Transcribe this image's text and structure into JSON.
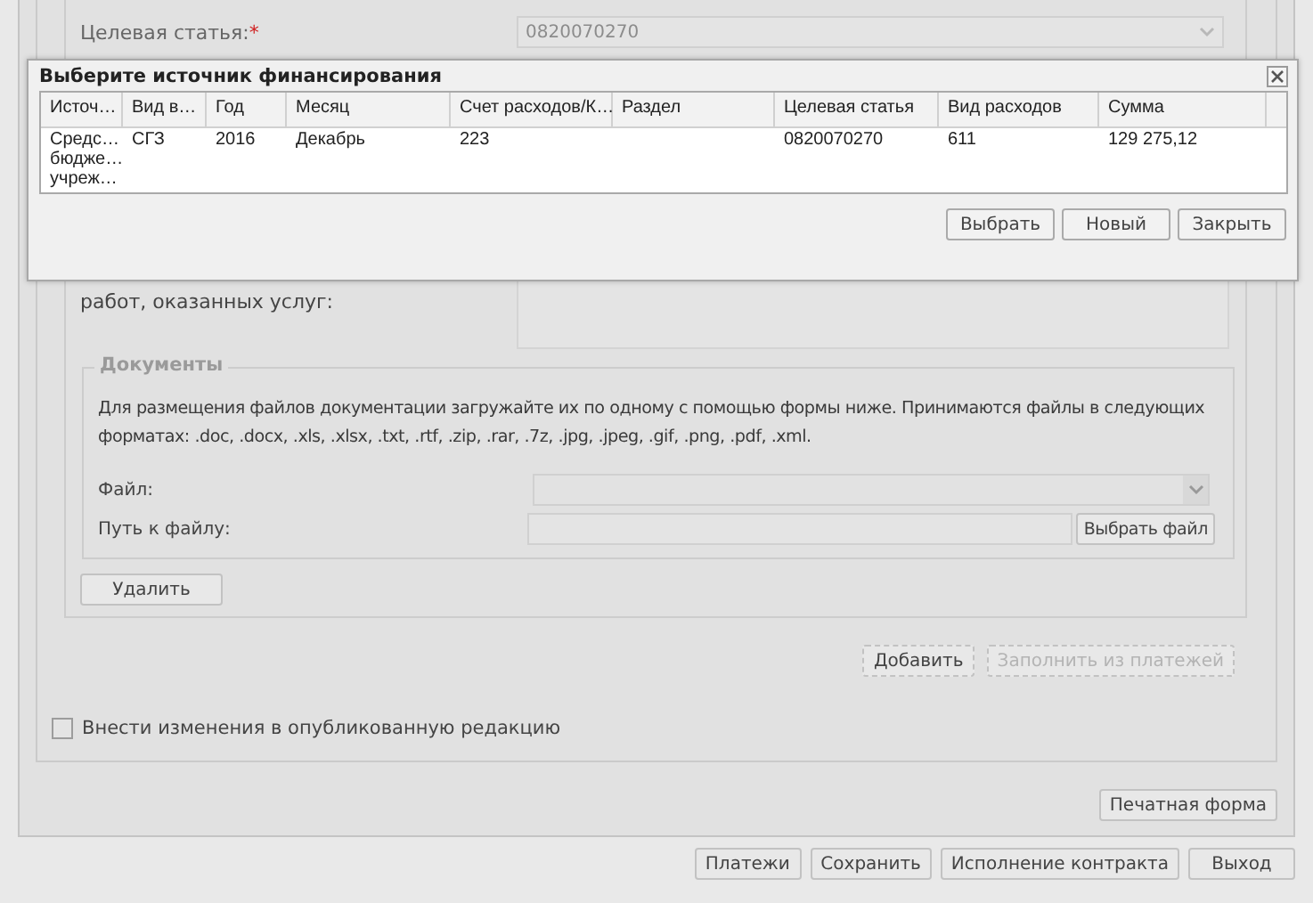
{
  "form": {
    "target_article": {
      "label": "Целевая статья:",
      "required_mark": "*",
      "value": "0820070270",
      "disabled": true
    },
    "description_label": "работ, оказанных услуг:",
    "documents": {
      "legend": "Документы",
      "hint": "Для размещения файлов документации загружайте их по одному с помощью формы ниже. Принимаются файлы в следующих форматах: .doc, .docx, .xls, .xlsx, .txt, .rtf, .zip, .rar, .7z, .jpg, .jpeg, .gif, .png, .pdf, .xml.",
      "file_label": "Файл:",
      "path_label": "Путь к файлу:",
      "browse_button": "Выбрать файл",
      "delete_button": "Удалить"
    },
    "add_button": "Добавить",
    "fill_button": {
      "label": "Заполнить из платежей",
      "disabled": true
    },
    "publish_checkbox": {
      "label": "Внести изменения в опубликованную редакцию",
      "checked": false
    },
    "print_button": "Печатная форма"
  },
  "footer_buttons": [
    "Платежи",
    "Сохранить",
    "Исполнение контракта",
    "Выход"
  ],
  "dialog": {
    "title": "Выберите источник финансирования",
    "columns": [
      "Источ…",
      "Вид в…",
      "Год",
      "Месяц",
      "Счет расходов/К…",
      "Раздел",
      "Целевая статья",
      "Вид расходов",
      "Сумма"
    ],
    "rows": [
      {
        "cells": [
          "Средс… бюдже… учреж…",
          "СГЗ",
          "2016",
          "Декабрь",
          "223",
          "",
          "0820070270",
          "611",
          "129 275,12"
        ]
      }
    ],
    "buttons": [
      "Выбрать",
      "Новый",
      "Закрыть"
    ]
  }
}
